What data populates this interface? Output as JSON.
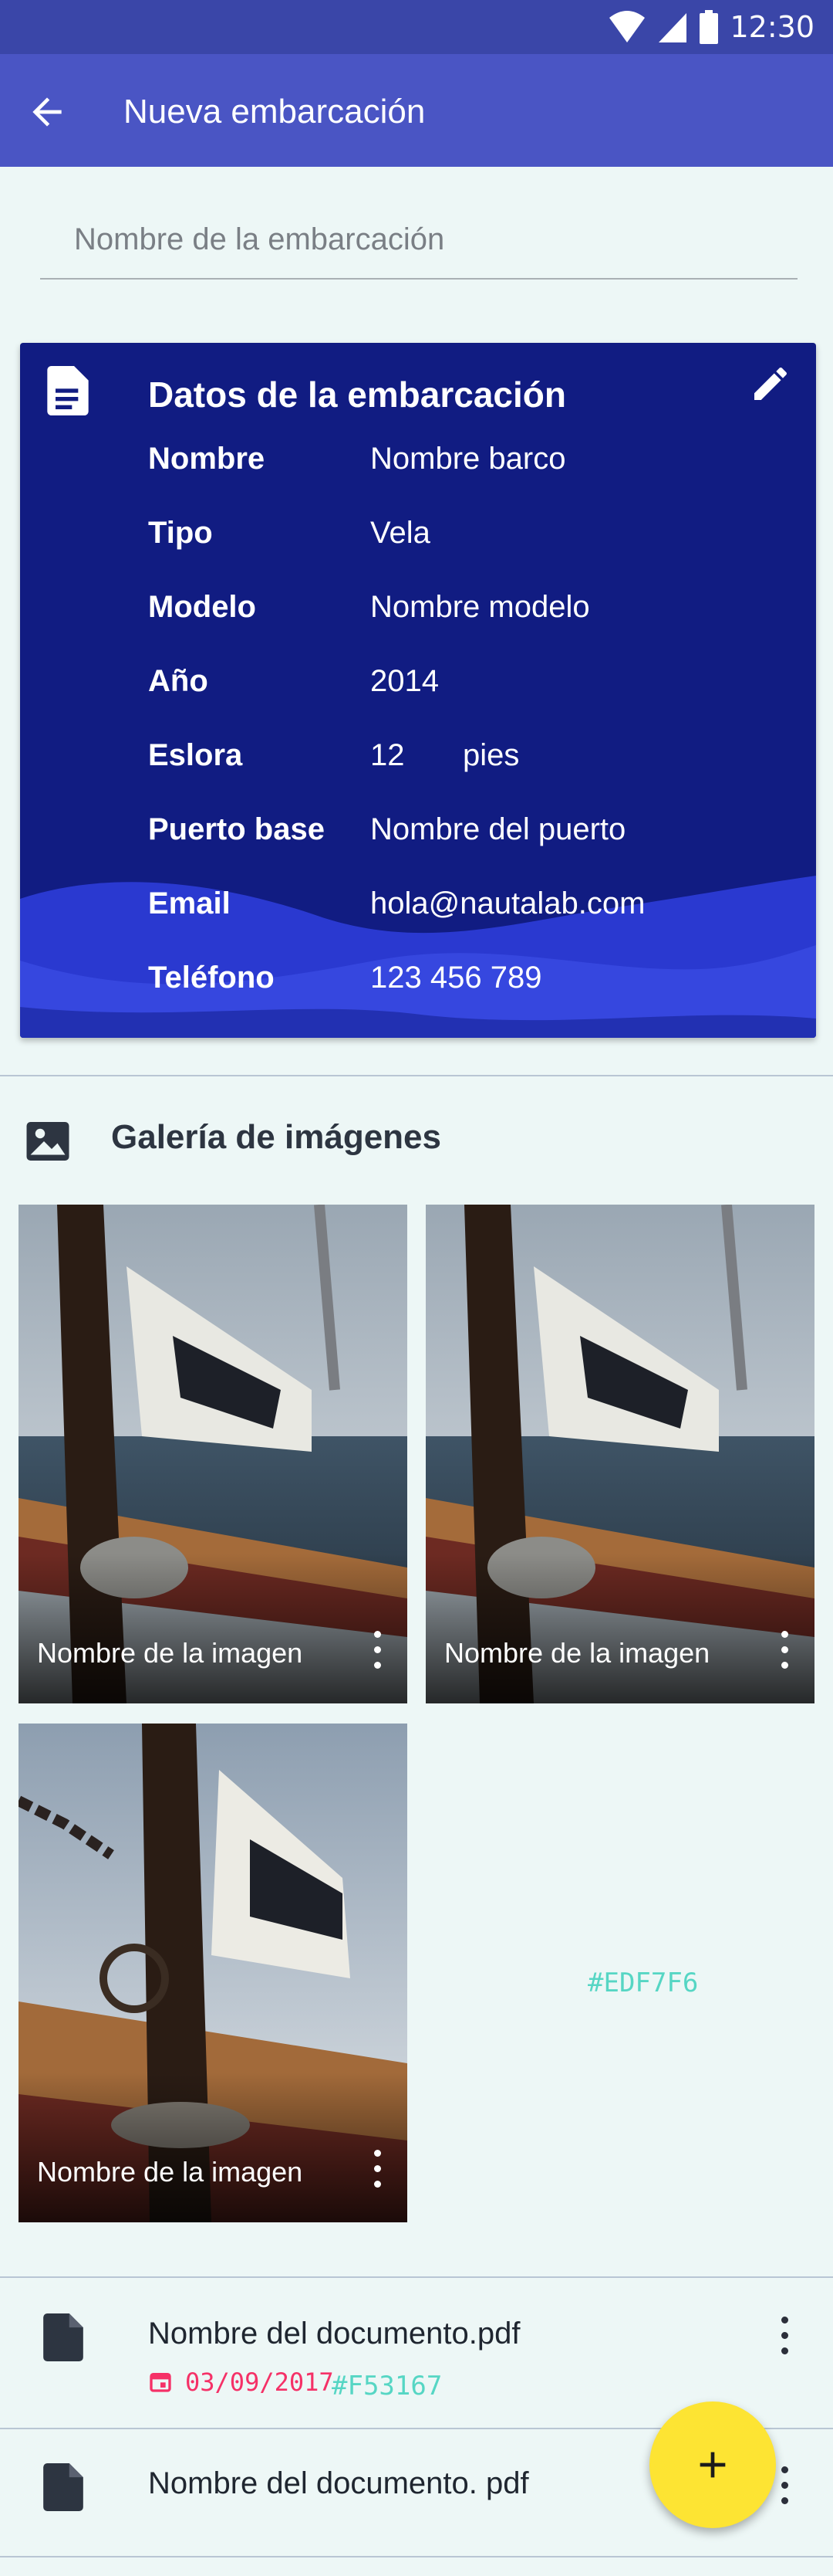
{
  "status_bar": {
    "time": "12:30",
    "icons": [
      "wifi-icon",
      "signal-icon",
      "battery-icon"
    ]
  },
  "app_bar": {
    "title": "Nueva embarcación",
    "back_icon": "arrow-back-icon"
  },
  "name_field": {
    "placeholder": "Nombre de la embarcación",
    "value": ""
  },
  "data_card": {
    "title": "Datos de la embarcación",
    "edit_icon": "pencil-icon",
    "doc_icon": "document-icon",
    "rows": [
      {
        "label": "Nombre",
        "value": "Nombre barco"
      },
      {
        "label": "Tipo",
        "value": "Vela"
      },
      {
        "label": "Modelo",
        "value": "Nombre modelo"
      },
      {
        "label": "Año",
        "value": "2014"
      },
      {
        "label": "Eslora",
        "value": "12",
        "unit": "pies"
      },
      {
        "label": "Puerto base",
        "value": "Nombre del puerto"
      },
      {
        "label": "Email",
        "value": "hola@nautalab.com"
      },
      {
        "label": "Teléfono",
        "value": "123 456 789"
      }
    ]
  },
  "gallery": {
    "title": "Galería de imágenes",
    "icon": "image-icon",
    "images": [
      {
        "caption": "Nombre de la imagen"
      },
      {
        "caption": "Nombre de la imagen"
      },
      {
        "caption": "Nombre de la imagen"
      }
    ],
    "background_note": "#EDF7F6"
  },
  "documents": [
    {
      "name": "Nombre del documento.pdf",
      "date": "03/09/2017",
      "color_note": "#F53167"
    },
    {
      "name": "Nombre del documento. pdf"
    }
  ],
  "colors": {
    "background": "#EDF7F6",
    "accent_date": "#F53167",
    "card": "#111c82",
    "app_bar": "#4a55c4",
    "fab": "#fde433"
  },
  "fab": {
    "icon": "plus-icon"
  }
}
